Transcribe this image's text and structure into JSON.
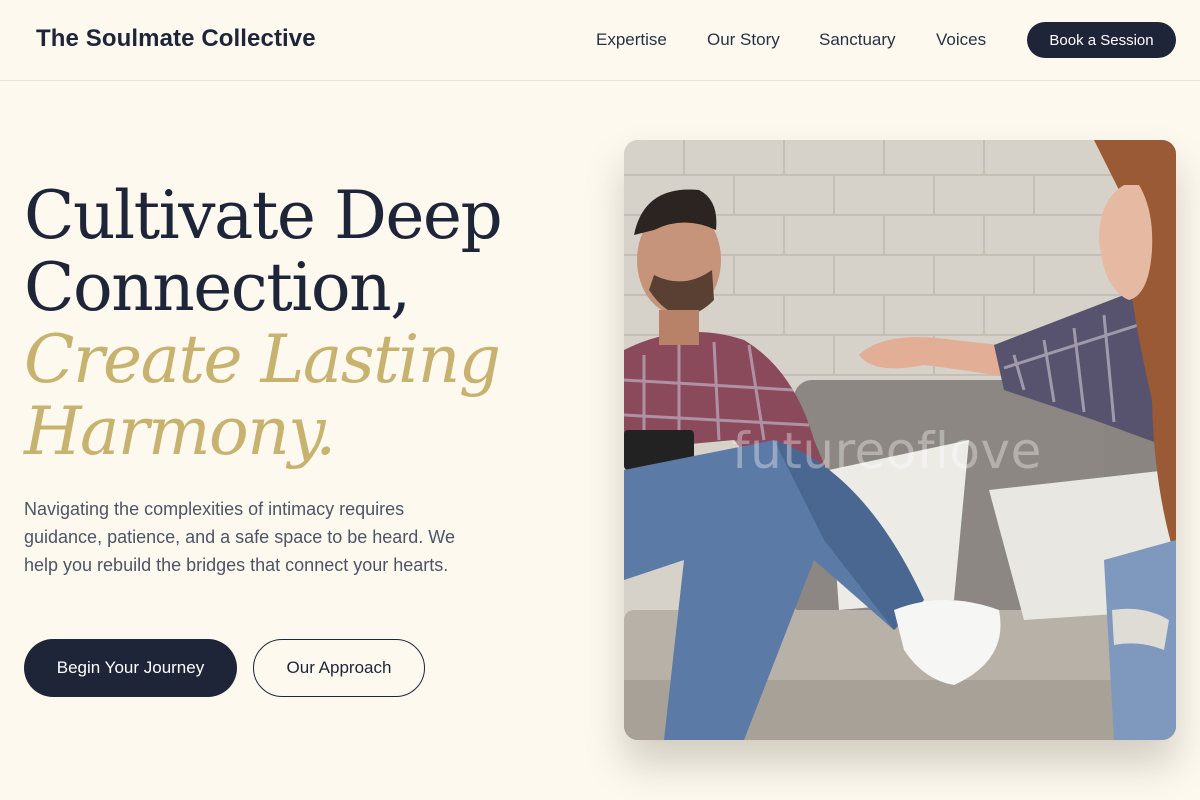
{
  "brand": {
    "name": "The Soulmate Collective"
  },
  "nav": {
    "links": [
      "Expertise",
      "Our Story",
      "Sanctuary",
      "Voices"
    ],
    "cta_label": "Book a Session"
  },
  "hero": {
    "headline_line1": "Cultivate Deep",
    "headline_line2": "Connection,",
    "accent_line1": "Create Lasting",
    "accent_line2": "Harmony.",
    "description": "Navigating the complexities of intimacy requires guidance, patience, and a safe space to be heard. We help you rebuild the bridges that connect your hearts.",
    "primary_button": "Begin Your Journey",
    "secondary_button": "Our Approach"
  },
  "photo": {
    "watermark": "futureoflove"
  },
  "colors": {
    "background": "#fdf9ef",
    "primary": "#1e2538",
    "accent": "#c7b36f",
    "body_text": "#4c5566"
  }
}
